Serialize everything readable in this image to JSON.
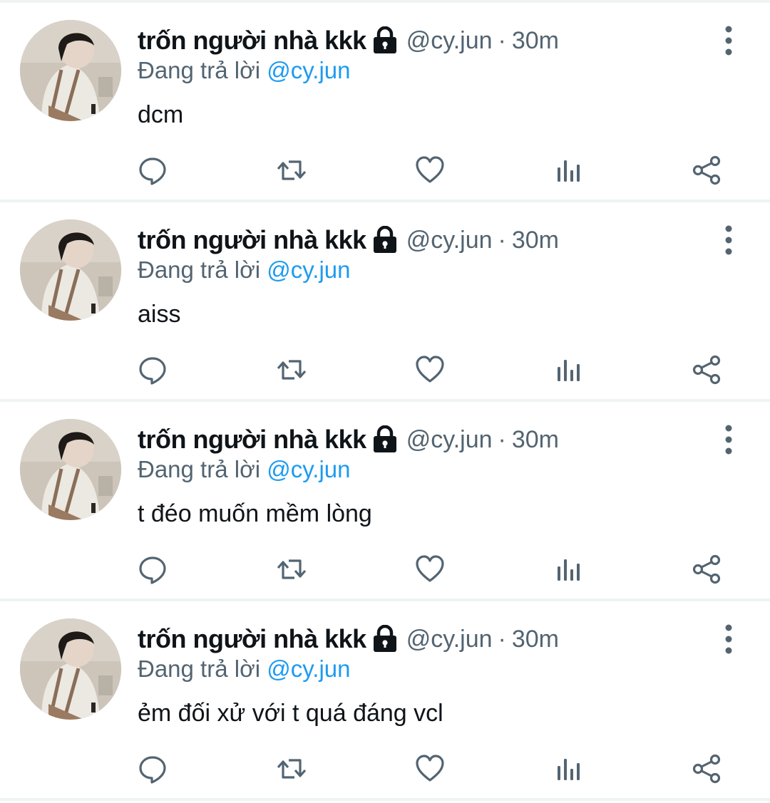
{
  "colors": {
    "text_primary": "#0f1419",
    "text_secondary": "#536471",
    "mention": "#1d9bf0",
    "divider": "#eff3f4"
  },
  "icons": {
    "lock": "lock-icon",
    "more": "more-vertical-icon",
    "reply": "reply-icon",
    "retweet": "retweet-icon",
    "like": "heart-icon",
    "views": "views-chart-icon",
    "share": "share-icon"
  },
  "tweets": [
    {
      "display_name": "trốn người nhà kkk",
      "handle": "@cy.jun",
      "separator": "·",
      "time": "30m",
      "reply_prefix": "Đang trả lời",
      "reply_to": "@cy.jun",
      "text": "dcm"
    },
    {
      "display_name": "trốn người nhà kkk",
      "handle": "@cy.jun",
      "separator": "·",
      "time": "30m",
      "reply_prefix": "Đang trả lời",
      "reply_to": "@cy.jun",
      "text": "aiss"
    },
    {
      "display_name": "trốn người nhà kkk",
      "handle": "@cy.jun",
      "separator": "·",
      "time": "30m",
      "reply_prefix": "Đang trả lời",
      "reply_to": "@cy.jun",
      "text": "t đéo muốn mềm lòng"
    },
    {
      "display_name": "trốn người nhà kkk",
      "handle": "@cy.jun",
      "separator": "·",
      "time": "30m",
      "reply_prefix": "Đang trả lời",
      "reply_to": "@cy.jun",
      "text": "ẻm đối xử với t quá đáng vcl"
    }
  ]
}
